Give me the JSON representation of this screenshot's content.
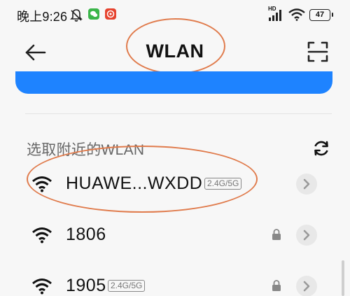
{
  "status_bar": {
    "time": "晚上9:26",
    "hd_label": "HD",
    "battery_level": "47",
    "icons": [
      "mute-bell-icon",
      "wechat-icon",
      "weibo-icon",
      "signal-icon",
      "wifi-icon",
      "battery-icon"
    ]
  },
  "header": {
    "title": "WLAN",
    "back_icon": "back-arrow-icon",
    "scan_icon": "scan-icon"
  },
  "section": {
    "title": "选取附近的WLAN",
    "refresh_icon": "refresh-icon"
  },
  "networks": [
    {
      "name": "HUAWE...WXDD",
      "band": "2.4G/5G",
      "locked": false
    },
    {
      "name": "1806",
      "band": "",
      "locked": true
    },
    {
      "name": "1905",
      "band": "2.4G/5G",
      "locked": true
    }
  ],
  "colors": {
    "accent_blue": "#1e83ff",
    "annotation": "#e07b4c",
    "background": "#f7f7f7",
    "wechat_green": "#3bb54a",
    "weibo_red": "#e6432f"
  }
}
